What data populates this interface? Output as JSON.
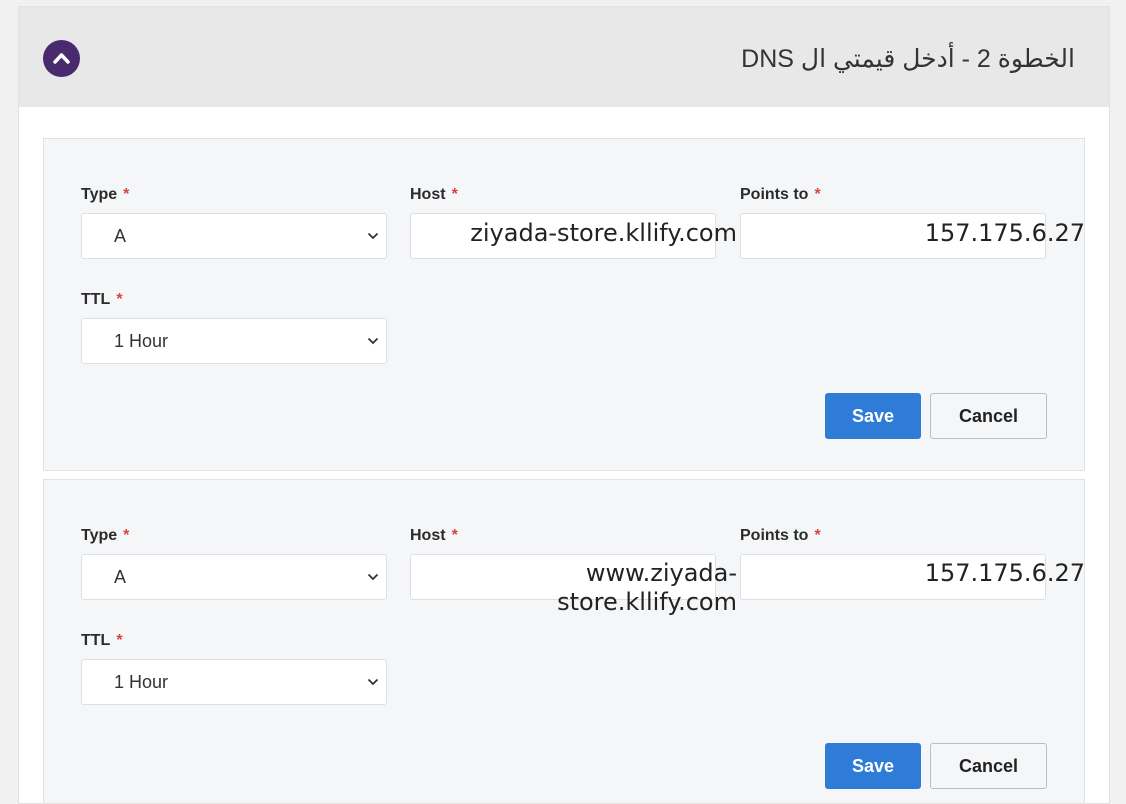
{
  "header": {
    "title": "الخطوة 2 - أدخل قيمتي ال DNS",
    "collapse_icon": "chevron-up-icon",
    "accent_color": "#4a2a6e"
  },
  "labels": {
    "type": "Type",
    "host": "Host",
    "points_to": "Points to",
    "ttl": "TTL",
    "required_mark": "*"
  },
  "records": [
    {
      "type": "A",
      "host": "ziyada-store.kllify.com",
      "points_to": "157.175.6.27",
      "ttl": "1 Hour",
      "save_label": "Save",
      "cancel_label": "Cancel"
    },
    {
      "type": "A",
      "host_line1": "www.ziyada-",
      "host_line2": "store.kllify.com",
      "points_to": "157.175.6.27",
      "ttl": "1 Hour",
      "save_label": "Save",
      "cancel_label": "Cancel"
    }
  ],
  "colors": {
    "save_button": "#2f7bd8",
    "required": "#d64545"
  }
}
